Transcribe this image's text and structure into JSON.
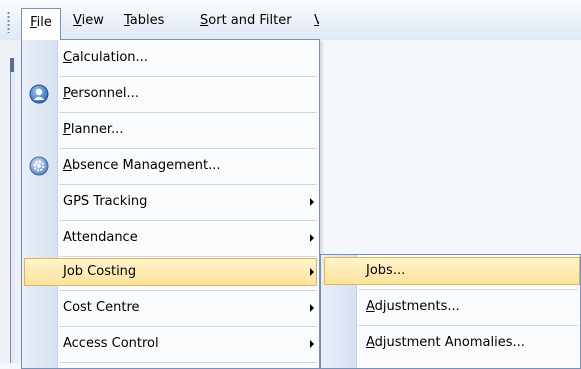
{
  "menubar": {
    "items": [
      {
        "key": "F",
        "rest": "ile"
      },
      {
        "key": "V",
        "rest": "iew"
      },
      {
        "key": "T",
        "rest": "ables"
      },
      {
        "key": "S",
        "rest": "ort and Filter"
      }
    ],
    "clipped": "V"
  },
  "file_menu": {
    "items": [
      {
        "key": "C",
        "rest": "alculation...",
        "icon": "",
        "submenu": false
      },
      {
        "key": "P",
        "rest": "ersonnel...",
        "icon": "personnel-icon",
        "submenu": false
      },
      {
        "key": "P",
        "rest": "lanner...",
        "icon": "",
        "submenu": false
      },
      {
        "key": "A",
        "rest": "bsence Management...",
        "icon": "absence-management-icon",
        "submenu": false
      },
      {
        "key": "",
        "rest": "GPS Tracking",
        "icon": "",
        "submenu": true
      },
      {
        "key": "",
        "rest": "Attendance",
        "icon": "",
        "submenu": true
      },
      {
        "key": "",
        "rest": "Job Costing",
        "icon": "",
        "submenu": true,
        "highlighted": true
      },
      {
        "key": "",
        "rest": "Cost Centre",
        "icon": "",
        "submenu": true
      },
      {
        "key": "",
        "rest": "Access Control",
        "icon": "",
        "submenu": true
      }
    ]
  },
  "job_costing_submenu": {
    "items": [
      {
        "key": "J",
        "rest": "obs...",
        "highlighted": true
      },
      {
        "key": "A",
        "rest": "djustments..."
      },
      {
        "key": "A",
        "rest": "djustment Anomalies..."
      }
    ]
  },
  "colors": {
    "highlight_top": "#fff4cd",
    "highlight_bottom": "#fde29b",
    "highlight_border": "#e3b44f",
    "menu_border": "#7690b8"
  }
}
